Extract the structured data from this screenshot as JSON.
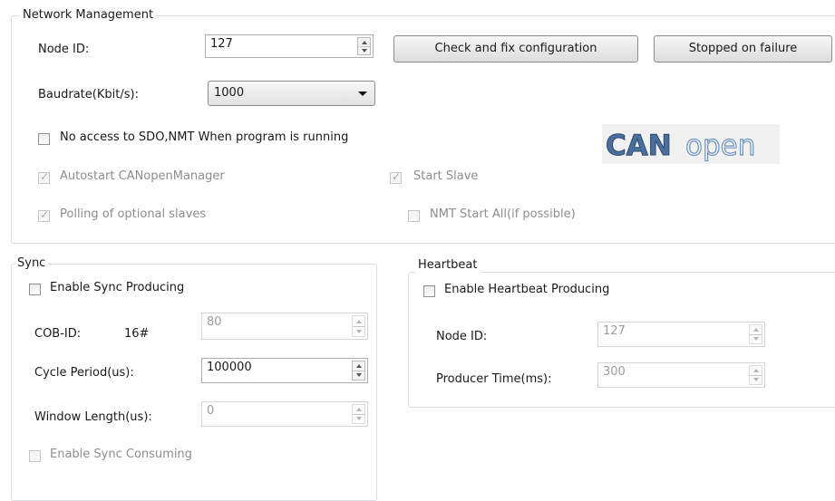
{
  "network_management": {
    "title": "Network Management",
    "node_id_label": "Node ID:",
    "node_id_value": "127",
    "check_fix_button": "Check and fix configuration",
    "stopped_failure_button": "Stopped on failure",
    "baudrate_label": "Baudrate(Kbit/s):",
    "baudrate_value": "1000",
    "no_access_label": "No access to SDO,NMT When program is running",
    "no_access_checked": false,
    "autostart_label": "Autostart CANopenManager",
    "autostart_checked": true,
    "start_slave_label": "Start Slave",
    "start_slave_checked": true,
    "polling_label": "Polling of optional slaves",
    "polling_checked": true,
    "nmt_start_all_label": "NMT Start All(if possible)",
    "nmt_start_all_checked": false,
    "logo_text_bold": "CAN",
    "logo_text_light": "open"
  },
  "sync": {
    "title": "Sync",
    "enable_producing_label": "Enable Sync Producing",
    "enable_producing_checked": false,
    "cob_id_label": "COB-ID:",
    "cob_id_prefix": "16#",
    "cob_id_value": "80",
    "cycle_period_label": "Cycle Period(us):",
    "cycle_period_value": "100000",
    "window_length_label": "Window Length(us):",
    "window_length_value": "0",
    "enable_consuming_label": "Enable Sync Consuming",
    "enable_consuming_checked": false
  },
  "heartbeat": {
    "title": "Heartbeat",
    "enable_producing_label": "Enable Heartbeat Producing",
    "enable_producing_checked": false,
    "node_id_label": "Node ID:",
    "node_id_value": "127",
    "producer_time_label": "Producer Time(ms):",
    "producer_time_value": "300"
  },
  "colors": {
    "group_border": "#d5dfe5",
    "disabled_text": "#8d8d8d",
    "logo_blue": "#4a6f9c"
  },
  "icons": [
    "spin-up-icon",
    "spin-down-icon",
    "dropdown-caret-icon",
    "checkmark-icon",
    "canopen-logo"
  ]
}
